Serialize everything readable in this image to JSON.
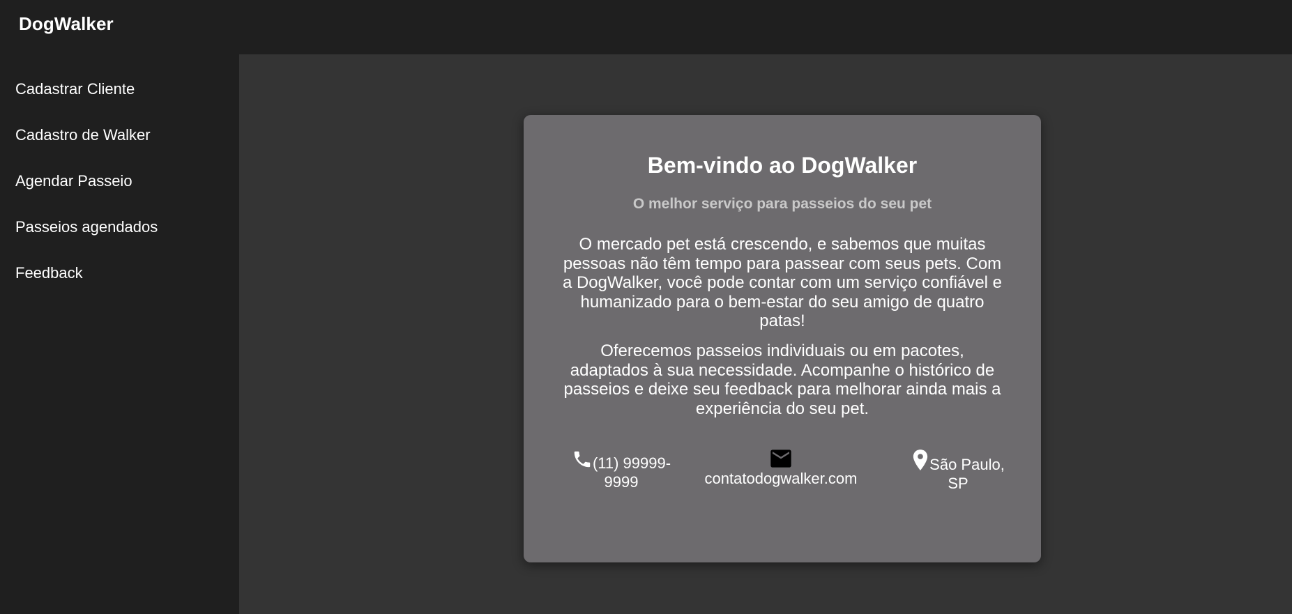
{
  "app": {
    "brand": "DogWalker"
  },
  "sidebar": {
    "items": [
      {
        "label": "Cadastrar Cliente"
      },
      {
        "label": "Cadastro de Walker"
      },
      {
        "label": "Agendar Passeio"
      },
      {
        "label": "Passeios agendados"
      },
      {
        "label": "Feedback"
      }
    ]
  },
  "welcome": {
    "title": "Bem-vindo ao DogWalker",
    "subtitle": "O melhor serviço para passeios do seu pet",
    "paragraph1": "O mercado pet está crescendo, e sabemos que muitas pessoas não têm tempo para passear com seus pets. Com a DogWalker, você pode contar com um serviço confiável e humanizado para o bem-estar do seu amigo de quatro patas!",
    "paragraph2": "Oferecemos passeios individuais ou em pacotes, adaptados à sua necessidade. Acompanhe o histórico de passeios e deixe seu feedback para melhorar ainda mais a experiência do seu pet."
  },
  "contact": {
    "phone": {
      "icon": "phone-icon",
      "text": "(11) 99999-9999"
    },
    "email": {
      "icon": "email-icon",
      "text": "contatodogwalker.com"
    },
    "location": {
      "icon": "location-pin-icon",
      "text": "São Paulo, SP"
    }
  },
  "colors": {
    "topbar_bg": "#1f1f1f",
    "sidebar_bg": "#1f1f1f",
    "main_bg": "#343434",
    "card_bg": "#6d6b6e",
    "subtitle_text": "#c9c9c9",
    "text": "#ffffff"
  }
}
